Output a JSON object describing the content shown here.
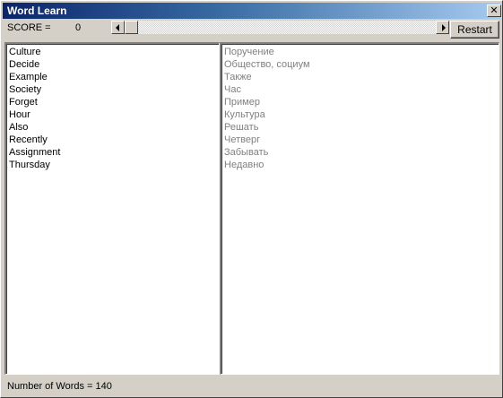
{
  "window": {
    "title": "Word Learn",
    "close_glyph": "✕"
  },
  "score": {
    "label": "SCORE =",
    "value": "0"
  },
  "toolbar": {
    "restart_label": "Restart"
  },
  "words_en": [
    "Culture",
    "Decide",
    "Example",
    "Society",
    "Forget",
    "Hour",
    "Also",
    "Recently",
    "Assignment",
    "Thursday"
  ],
  "words_ru": [
    "Поручение",
    "Общество, социум",
    "Также",
    "Час",
    "Пример",
    "Культура",
    "Решать",
    "Четверг",
    "Забывать",
    "Недавно"
  ],
  "status": {
    "text": "Number of Words = 140"
  },
  "icons": {
    "close": "close-icon",
    "scroll_left": "arrow-left-icon",
    "scroll_right": "arrow-right-icon"
  },
  "colors": {
    "title_gradient_start": "#0a246a",
    "title_gradient_end": "#a6caf0",
    "window_bg": "#d4d0c8",
    "translation_text": "#808080"
  }
}
